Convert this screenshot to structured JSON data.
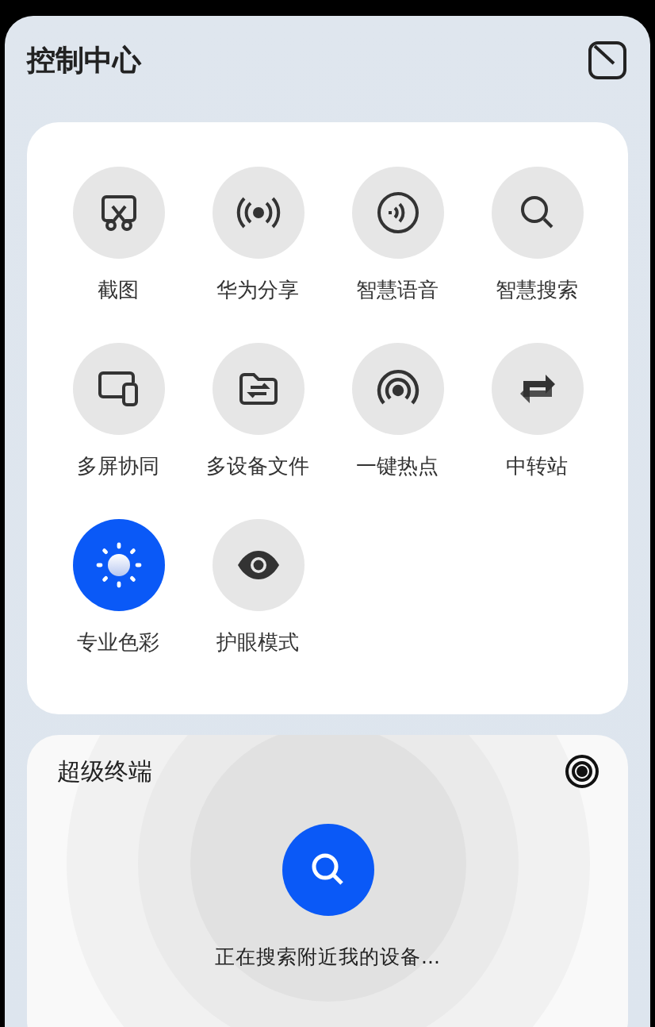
{
  "header": {
    "title": "控制中心"
  },
  "tiles": [
    {
      "kind": "screenshot",
      "label": "截图",
      "on": false
    },
    {
      "kind": "share",
      "label": "华为分享",
      "on": false
    },
    {
      "kind": "voice",
      "label": "智慧语音",
      "on": false
    },
    {
      "kind": "search",
      "label": "智慧搜索",
      "on": false
    },
    {
      "kind": "multiscreen",
      "label": "多屏协同",
      "on": false
    },
    {
      "kind": "files",
      "label": "多设备文件",
      "on": false
    },
    {
      "kind": "hotspot",
      "label": "一键热点",
      "on": false
    },
    {
      "kind": "transfer",
      "label": "中转站",
      "on": false
    },
    {
      "kind": "color",
      "label": "专业色彩",
      "on": true
    },
    {
      "kind": "eye",
      "label": "护眼模式",
      "on": false
    }
  ],
  "super_device": {
    "title": "超级终端",
    "status": "正在搜索附近我的设备..."
  }
}
